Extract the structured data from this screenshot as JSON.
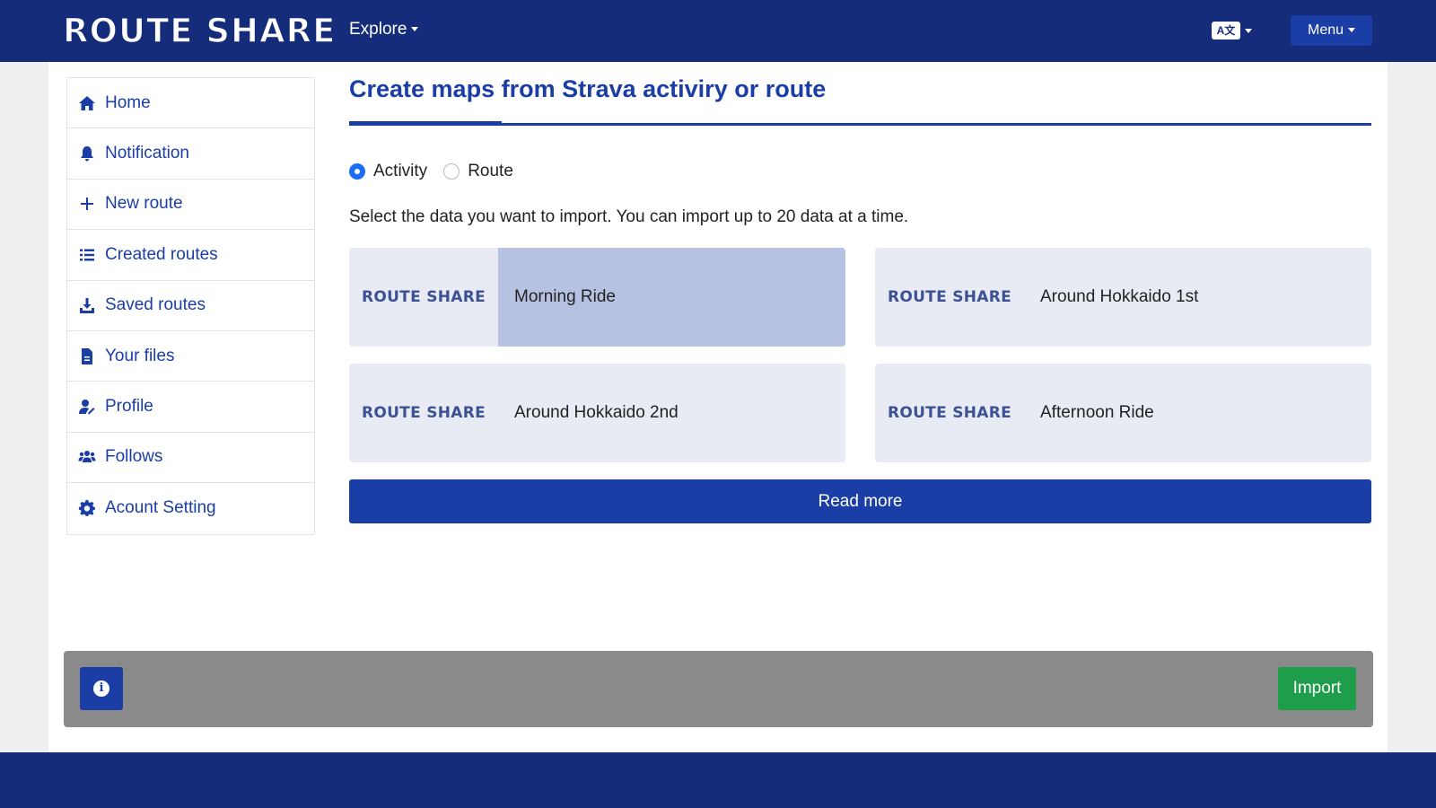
{
  "header": {
    "logo": "ROUTE SHARE",
    "explore_label": "Explore",
    "lang_icon": "translate-icon",
    "lang_label": "A文",
    "menu_label": "Menu"
  },
  "sidebar": {
    "items": [
      {
        "label": "Home",
        "icon": "home-icon"
      },
      {
        "label": "Notification",
        "icon": "bell-icon"
      },
      {
        "label": "New route",
        "icon": "plus-icon"
      },
      {
        "label": "Created routes",
        "icon": "list-icon"
      },
      {
        "label": "Saved routes",
        "icon": "download-icon"
      },
      {
        "label": "Your files",
        "icon": "file-icon"
      },
      {
        "label": "Profile",
        "icon": "user-edit-icon"
      },
      {
        "label": "Follows",
        "icon": "users-icon"
      },
      {
        "label": "Acount Setting",
        "icon": "gear-icon"
      }
    ]
  },
  "main": {
    "title": "Create maps from Strava activiry or route",
    "radios": [
      {
        "label": "Activity",
        "checked": true
      },
      {
        "label": "Route",
        "checked": false
      }
    ],
    "instruction": "Select the data you want to import. You can import up to 20 data at a time.",
    "cards": [
      {
        "thumb": "ROUTE SHARE",
        "name": "Morning Ride",
        "selected": true
      },
      {
        "thumb": "ROUTE SHARE",
        "name": "Around Hokkaido 1st",
        "selected": false
      },
      {
        "thumb": "ROUTE SHARE",
        "name": "Around Hokkaido 2nd",
        "selected": false
      },
      {
        "thumb": "ROUTE SHARE",
        "name": "Afternoon Ride",
        "selected": false
      }
    ],
    "read_more_label": "Read more"
  },
  "footer": {
    "info_icon": "info-icon",
    "info_glyph": "i",
    "import_label": "Import"
  },
  "colors": {
    "primary": "#1b3da6",
    "navbar": "#142c7a",
    "selected_card": "#b7c2e2",
    "card_bg": "#e8ebf3",
    "import_green": "#1e9e4a",
    "footer_bar": "#8a8a8a"
  }
}
